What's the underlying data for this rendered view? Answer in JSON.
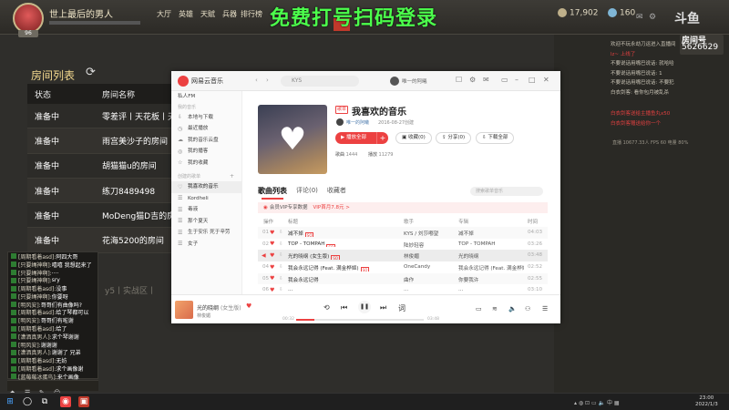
{
  "game": {
    "player_name": "世上最后的男人",
    "level": "96",
    "nav": [
      "大厅",
      "英雄",
      "天赋",
      "兵器",
      "排行榜"
    ],
    "overlay_text": "免费打号扫码登录",
    "coins": "17,902",
    "gems": "160",
    "room_list_title": "房间列表",
    "room_table_headers": [
      "状态",
      "房间名称"
    ],
    "rooms": [
      {
        "status": "准备中",
        "name": "零差评丨天花板丨天"
      },
      {
        "status": "准备中",
        "name": "雨宫美沙子的房间"
      },
      {
        "status": "准备中",
        "name": "胡猫猫u的房间"
      },
      {
        "status": "准备中",
        "name": "练刀8489498"
      },
      {
        "status": "准备中",
        "name": "MoDeng猫D吉的房间"
      },
      {
        "status": "准备中",
        "name": "花海5200的房间"
      }
    ],
    "faint_text": "y5丨实战区丨",
    "room_number_label": "房间号",
    "room_number": "5626629"
  },
  "stream_overlay": {
    "brand": "斗鱼",
    "right_lines": [
      {
        "text": "欢迎不玩永劫刀运进入直播间",
        "red": false
      },
      {
        "text": "lz~ 上线了",
        "red": true
      },
      {
        "text": "不要说话用嘴巴说话: 就哈哈",
        "red": false
      },
      {
        "text": "不要说话用嘴巴说话: 1",
        "red": false
      },
      {
        "text": "不要说话用嘴巴说话: 不要犯",
        "red": false
      },
      {
        "text": "白衣剑客: 看你包月被乱杀",
        "red": false
      }
    ],
    "right_lines2": [
      {
        "text": "白衣剑客送给主播鱼丸x50",
        "red": true
      },
      {
        "text": "白衣剑客赠送给你一个",
        "red": true
      }
    ],
    "stats_line": "直播 10677.33人  FPS 60  电量 80%",
    "chat": [
      {
        "user": "[周期看着asd]:",
        "msg": "阿四大哥"
      },
      {
        "user": "[只要绳神啊]:",
        "msg": "嘻嘻 我想起来了"
      },
      {
        "user": "[只要绳神啊]:",
        "msg": "...."
      },
      {
        "user": "[只要绳神啊]:",
        "msg": "sry"
      },
      {
        "user": "[周期看着asd]:",
        "msg": "没事"
      },
      {
        "user": "[只要绳神啊]:",
        "msg": "你要呀"
      },
      {
        "user": "[明风安]:",
        "msg": "哥哥们有曲像吗?"
      },
      {
        "user": "[周期看着asd]:",
        "msg": "给了琴都可以"
      },
      {
        "user": "[明风安]:",
        "msg": "哥哥们有啦谢"
      },
      {
        "user": "[周期看着asd]:",
        "msg": "给了"
      },
      {
        "user": "[潇洒真男人]:",
        "msg": "求个琴谢谢"
      },
      {
        "user": "[明风安]:",
        "msg": "谢谢谢"
      },
      {
        "user": "[潇洒真男人]:",
        "msg": "谢谢了 兄弟"
      },
      {
        "user": "[周期看着asd]:",
        "msg": "无妨"
      },
      {
        "user": "[周期看着asd]:",
        "msg": "求个画像谢"
      },
      {
        "user": "[蓝莓莓冰蛋鸟]:",
        "msg": "来个画像"
      }
    ]
  },
  "music": {
    "app_name": "网易云音乐",
    "search_placeholder": "KYS",
    "user_name": "唯一的阿曦",
    "sidebar": {
      "fm": "私人FM",
      "section_my": "我的音乐",
      "items_my": [
        "本地与下载",
        "最近播放",
        "我的音乐云盘",
        "我的播客",
        "我的收藏"
      ],
      "section_created": "创建的歌单",
      "items_created": [
        "我喜欢的音乐",
        "Kordheli",
        "毒液",
        "那个夏天",
        "生于安乐 死于辛劳",
        "女子"
      ]
    },
    "playlist": {
      "tag": "歌单",
      "title": "我喜欢的音乐",
      "creator": "唯一的阿曦",
      "created": "2016-08-27创建",
      "play_all": "播放全部",
      "collect": "收藏(0)",
      "share": "分享(0)",
      "download": "下载全部",
      "songs_label": "歌曲",
      "songs_count": "1444",
      "plays_label": "播放",
      "plays_count": "11279"
    },
    "tabs": [
      "歌曲列表",
      "评论(0)",
      "收藏者"
    ],
    "search_in_playlist": "搜索歌单音乐",
    "vip_banner": "会员VIP专享数据",
    "vip_link": "VIP首月7.8元 >",
    "columns": [
      "操作",
      "标题",
      "歌手",
      "专辑",
      "时间"
    ],
    "songs": [
      {
        "idx": "01",
        "title": "减不掉",
        "tag": "SQ",
        "artist": "KYS / 刘莎嘟望",
        "album": "减不掉",
        "dur": "04:03",
        "playing": false
      },
      {
        "idx": "02",
        "title": "TOP - TOMPAH",
        "tag": "SQ",
        "artist": "陆妙轻容",
        "album": "TOP - TOMPAH",
        "dur": "03:26",
        "playing": false
      },
      {
        "idx": "03",
        "title": "光的晓纲 (女生版)",
        "tag": "SQ",
        "artist": "林俊媚",
        "album": "光的晓纲",
        "dur": "03:48",
        "playing": true
      },
      {
        "idx": "04",
        "title": "我会永远记得 (Feat. 满金桦姬)",
        "tag": "SQ",
        "artist": "OneCandy",
        "album": "我会永远记得 (Feat. 满金桦姬)",
        "dur": "02:52",
        "playing": false
      },
      {
        "idx": "05",
        "title": "我会永远记得",
        "tag": "",
        "artist": "曲作",
        "album": "你要我许",
        "dur": "02:55",
        "playing": false
      },
      {
        "idx": "06",
        "title": "...",
        "tag": "",
        "artist": "...",
        "album": "...",
        "dur": "03:10",
        "playing": false
      }
    ],
    "now_playing": {
      "title": "光的晓纲",
      "subtitle": "(女生版)",
      "artist": "林俊媚",
      "time_current": "00:32",
      "time_total": "03:48",
      "progress": 0.14
    }
  },
  "taskbar": {
    "time": "23:00",
    "date": "2022/1/3"
  }
}
